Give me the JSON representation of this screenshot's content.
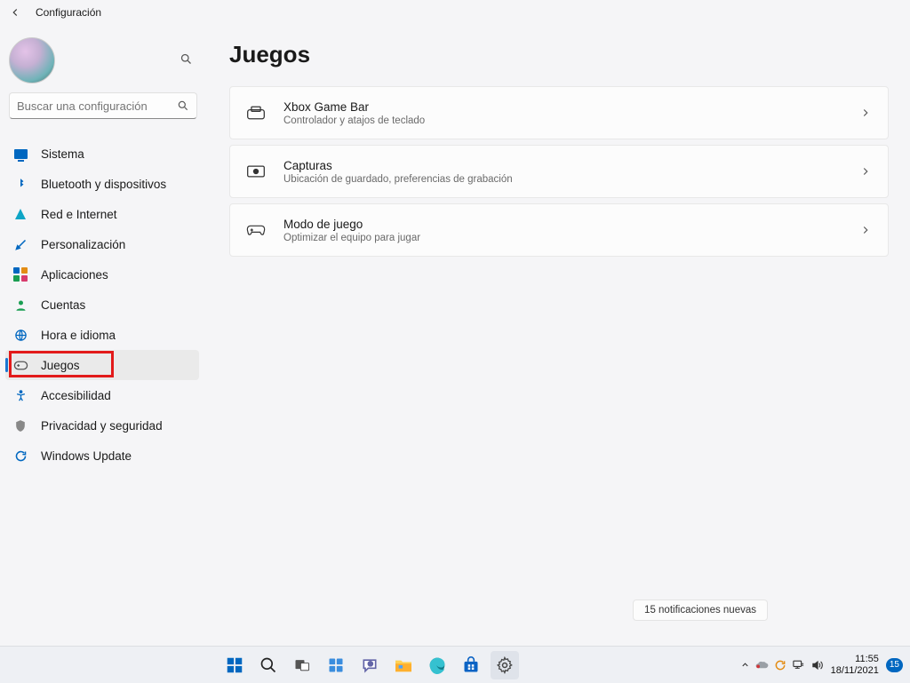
{
  "app_title": "Configuración",
  "search": {
    "placeholder": "Buscar una configuración"
  },
  "sidebar": {
    "active_index": 7,
    "items": [
      {
        "label": "Sistema",
        "icon": "system-icon"
      },
      {
        "label": "Bluetooth y dispositivos",
        "icon": "bluetooth-icon"
      },
      {
        "label": "Red e Internet",
        "icon": "wifi-icon"
      },
      {
        "label": "Personalización",
        "icon": "brush-icon"
      },
      {
        "label": "Aplicaciones",
        "icon": "apps-icon"
      },
      {
        "label": "Cuentas",
        "icon": "account-icon"
      },
      {
        "label": "Hora e idioma",
        "icon": "globe-clock-icon"
      },
      {
        "label": "Juegos",
        "icon": "gamepad-icon"
      },
      {
        "label": "Accesibilidad",
        "icon": "accessibility-icon"
      },
      {
        "label": "Privacidad y seguridad",
        "icon": "shield-icon"
      },
      {
        "label": "Windows Update",
        "icon": "update-icon"
      }
    ]
  },
  "main": {
    "title": "Juegos",
    "cards": [
      {
        "title": "Xbox Game Bar",
        "description": "Controlador y atajos de teclado",
        "icon": "gamebar-icon"
      },
      {
        "title": "Capturas",
        "description": "Ubicación de guardado, preferencias de grabación",
        "icon": "captures-icon"
      },
      {
        "title": "Modo de juego",
        "description": "Optimizar el equipo para jugar",
        "icon": "gamemode-icon"
      }
    ]
  },
  "toast": {
    "text": "15 notificaciones nuevas"
  },
  "taskbar": {
    "time": "11:55",
    "date": "18/11/2021",
    "notification_count": "15",
    "center_items": [
      {
        "name": "start-icon"
      },
      {
        "name": "search-icon"
      },
      {
        "name": "taskview-icon"
      },
      {
        "name": "widgets-icon"
      },
      {
        "name": "chat-icon"
      },
      {
        "name": "explorer-icon"
      },
      {
        "name": "edge-icon"
      },
      {
        "name": "store-icon"
      },
      {
        "name": "settings-icon"
      }
    ]
  },
  "highlight": {
    "nav_index": 7
  }
}
